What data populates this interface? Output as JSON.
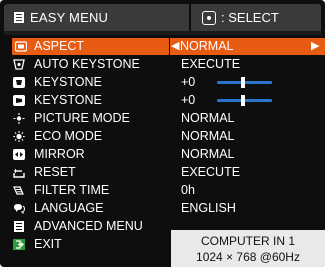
{
  "header": {
    "title": "EASY MENU",
    "title_icon": "menu-list-icon",
    "hint_icon": "select-button-icon",
    "hint_text": ": SELECT"
  },
  "menu": {
    "items": [
      {
        "label": "ASPECT",
        "value": "NORMAL",
        "icon": "aspect-icon",
        "selected": true
      },
      {
        "label": "AUTO KEYSTONE",
        "value": "EXECUTE",
        "icon": "auto-keystone-icon"
      },
      {
        "label": "KEYSTONE",
        "value": "+0",
        "icon": "vertical-keystone-icon",
        "slider": true
      },
      {
        "label": "KEYSTONE",
        "value": "+0",
        "icon": "horizontal-keystone-icon",
        "slider": true
      },
      {
        "label": "PICTURE MODE",
        "value": "NORMAL",
        "icon": "picture-mode-icon"
      },
      {
        "label": "ECO MODE",
        "value": "NORMAL",
        "icon": "eco-mode-icon"
      },
      {
        "label": "MIRROR",
        "value": "NORMAL",
        "icon": "mirror-icon"
      },
      {
        "label": "RESET",
        "value": "EXECUTE",
        "icon": "reset-icon"
      },
      {
        "label": "FILTER TIME",
        "value": "0h",
        "icon": "filter-time-icon"
      },
      {
        "label": "LANGUAGE",
        "value": "ENGLISH",
        "icon": "language-icon"
      },
      {
        "label": "ADVANCED MENU",
        "value": "",
        "icon": "advanced-menu-icon"
      },
      {
        "label": "EXIT",
        "value": "",
        "icon": "exit-icon"
      }
    ]
  },
  "info": {
    "source": "COMPUTER IN 1",
    "resolution": "1024 × 768 @60Hz"
  },
  "colors": {
    "highlight": "#e85b12",
    "slider": "#2b74c8",
    "background": "#0f0e0e",
    "header": "#3a3a3a"
  }
}
